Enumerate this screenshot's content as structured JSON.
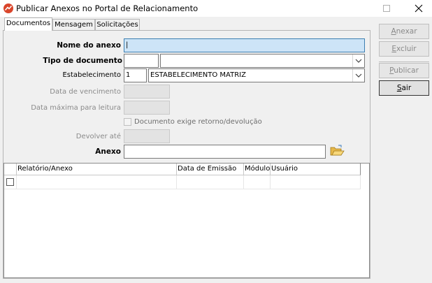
{
  "window": {
    "title": "Publicar Anexos no Portal de Relacionamento"
  },
  "tabs": [
    {
      "label": "Documentos",
      "active": true
    },
    {
      "label": "Mensagem",
      "active": false
    },
    {
      "label": "Solicitações",
      "active": false
    }
  ],
  "form": {
    "nome_anexo": {
      "label": "Nome do anexo",
      "value": "|"
    },
    "tipo_documento": {
      "label": "Tipo de documento",
      "code": "",
      "name": ""
    },
    "estabelecimento": {
      "label": "Estabelecimento",
      "code": "1",
      "name": "ESTABELECIMENTO MATRIZ"
    },
    "data_vencimento": {
      "label": "Data de vencimento",
      "value": ""
    },
    "data_maxima": {
      "label": "Data máxima para leitura",
      "value": ""
    },
    "exige_retorno": {
      "label": "Documento exige retorno/devolução",
      "checked": false
    },
    "devolver_ate": {
      "label": "Devolver até",
      "value": ""
    },
    "anexo": {
      "label": "Anexo",
      "value": ""
    }
  },
  "grid": {
    "columns": [
      "Relatório/Anexo",
      "Data de Emissão",
      "Módulo",
      "Usuário"
    ],
    "rows": [
      {
        "checked": false,
        "cells": [
          "",
          "",
          "",
          ""
        ]
      }
    ]
  },
  "actions": {
    "anexar": {
      "label": "Anexar",
      "mnemonic": "A",
      "rest": "nexar"
    },
    "excluir": {
      "label": "Excluir",
      "mnemonic": "E",
      "rest": "xcluir"
    },
    "publicar": {
      "label": "Publicar",
      "mnemonic": "P",
      "rest": "ublicar"
    },
    "sair": {
      "label": "Sair",
      "mnemonic": "S",
      "rest": "air"
    }
  },
  "colors": {
    "focus_field": "#cde4f7",
    "focus_border": "#3c7fb1",
    "window_bg": "#f0f0f0"
  },
  "icons": [
    "app-icon",
    "maximize-icon",
    "close-icon",
    "dropdown-arrow-icon",
    "folder-open-icon",
    "checkbox-icon"
  ]
}
